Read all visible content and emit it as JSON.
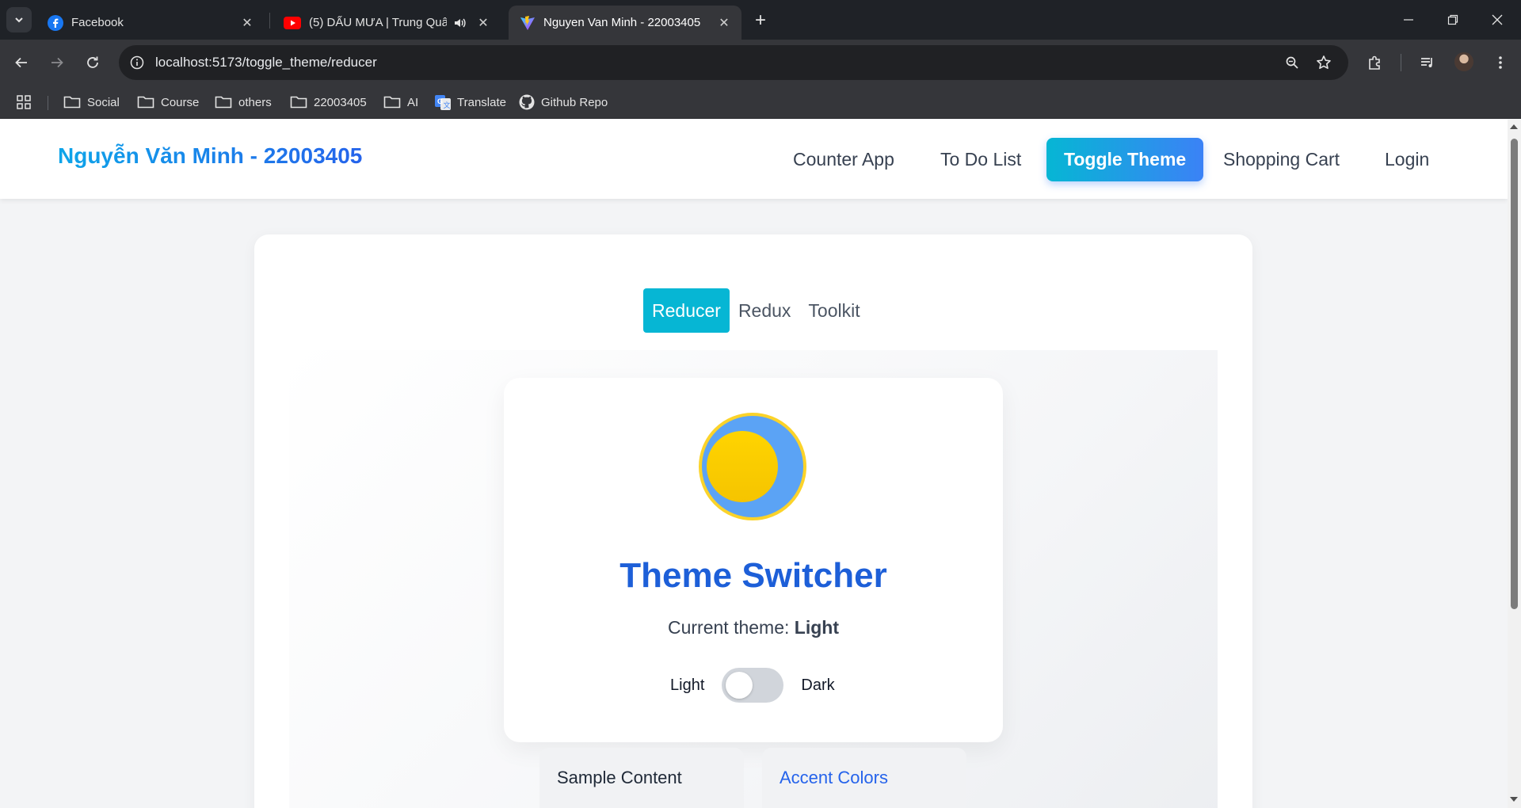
{
  "browser": {
    "tabs": [
      {
        "title": "Facebook",
        "icon": "facebook-icon"
      },
      {
        "title": "(5) DẤU MƯA | Trung Quân",
        "icon": "youtube-icon",
        "audio": true
      },
      {
        "title": "Nguyen Van Minh - 22003405",
        "icon": "vite-icon",
        "active": true
      }
    ],
    "url": "localhost:5173/toggle_theme/reducer",
    "bookmarks": [
      {
        "label": "Social",
        "icon": "folder-icon"
      },
      {
        "label": "Course",
        "icon": "folder-icon"
      },
      {
        "label": "others",
        "icon": "folder-icon"
      },
      {
        "label": "22003405",
        "icon": "folder-icon"
      },
      {
        "label": "AI",
        "icon": "folder-icon"
      },
      {
        "label": "Translate",
        "icon": "google-translate-icon"
      },
      {
        "label": "Github Repo",
        "icon": "github-icon"
      }
    ]
  },
  "app": {
    "brand": "Nguyễn Văn Minh - 22003405",
    "nav": [
      {
        "label": "Counter App"
      },
      {
        "label": "To Do List"
      },
      {
        "label": "Toggle Theme",
        "active": true
      },
      {
        "label": "Shopping Cart"
      },
      {
        "label": "Login"
      }
    ],
    "subtabs": [
      {
        "label": "Reducer",
        "active": true
      },
      {
        "label": "Redux"
      },
      {
        "label": "Toolkit"
      }
    ],
    "theme_card": {
      "title": "Theme Switcher",
      "current_prefix": "Current theme: ",
      "current_value": "Light",
      "toggle_left": "Light",
      "toggle_right": "Dark",
      "toggle_on": false
    },
    "cards": [
      {
        "title": "Sample Content"
      },
      {
        "title": "Accent Colors"
      }
    ]
  },
  "colors": {
    "accent": "#06b6d4",
    "brand_blue": "#2563eb",
    "title_blue": "#1d5fd8",
    "sun_yellow": "#ffd200",
    "sun_ring": "#5ba3f5"
  }
}
